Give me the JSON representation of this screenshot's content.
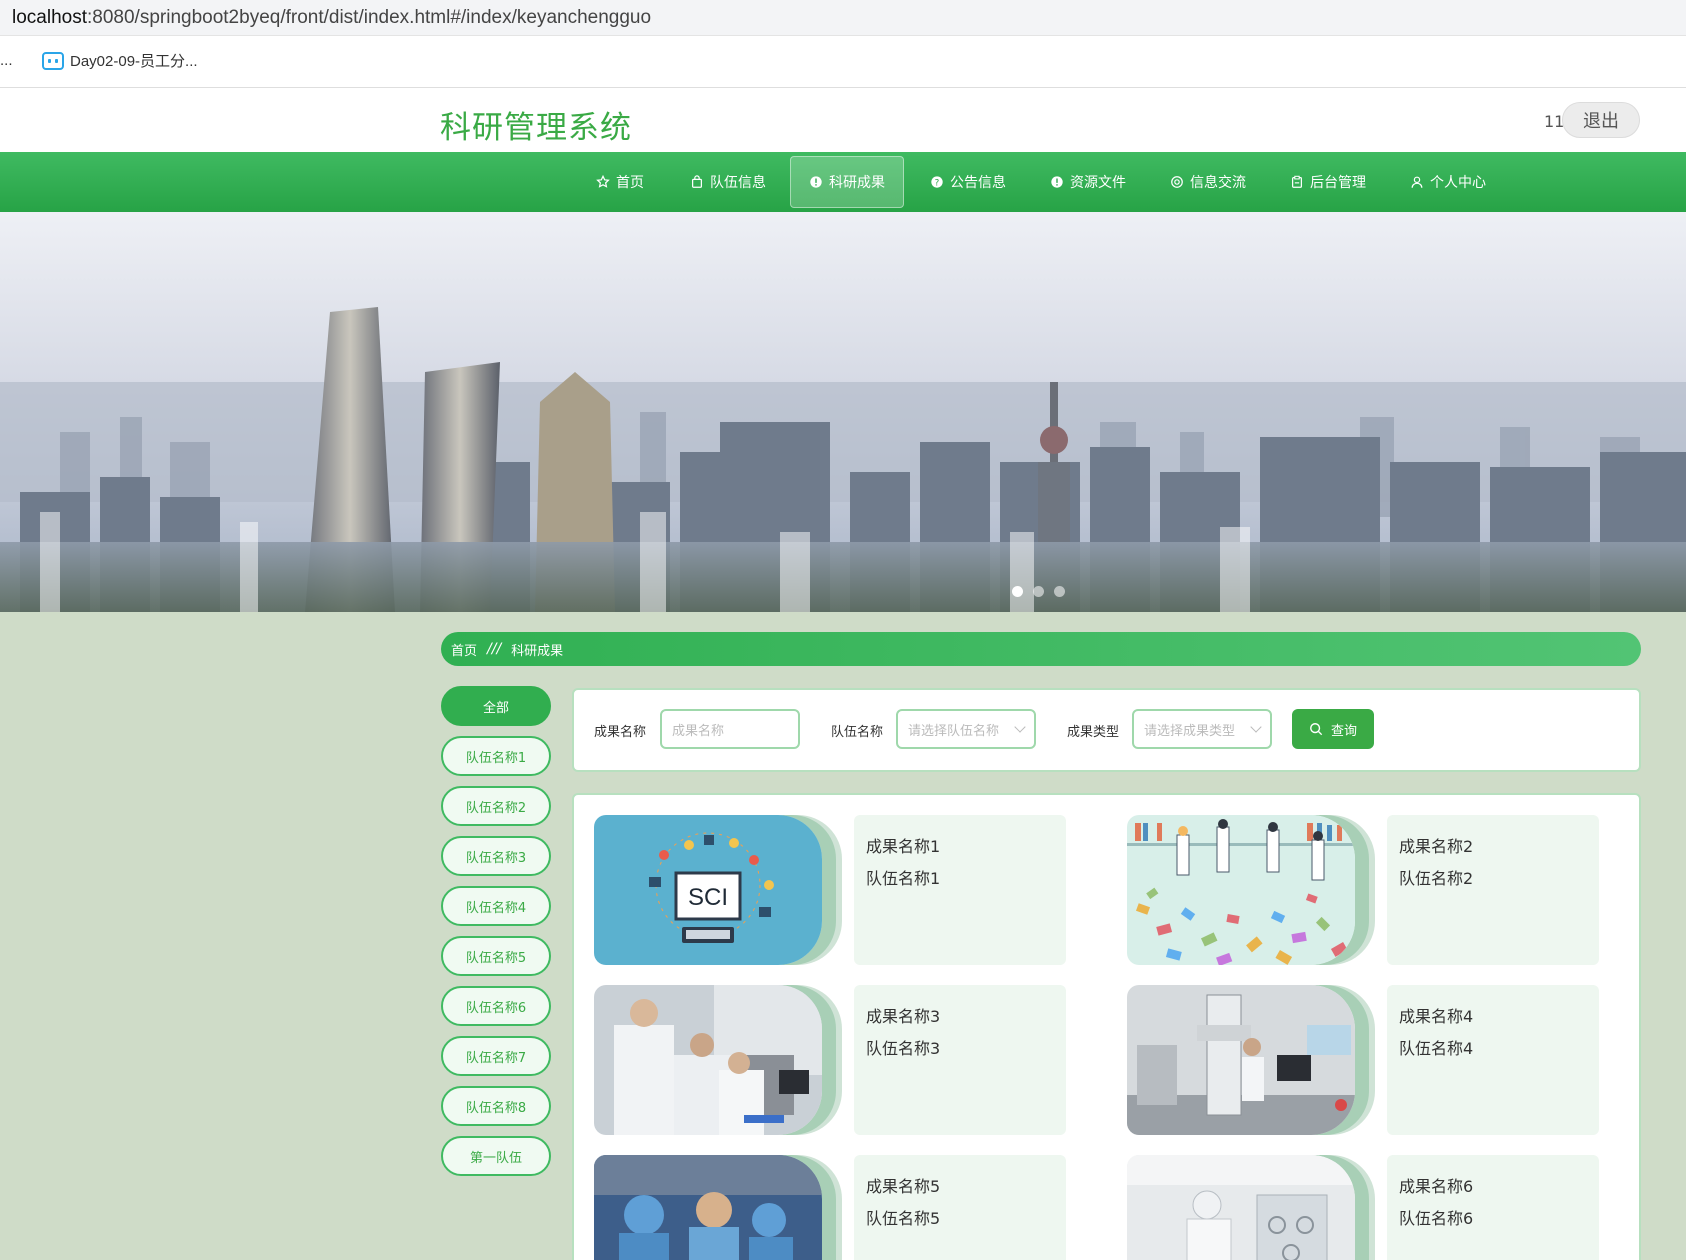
{
  "browser": {
    "url_host": "localhost",
    "url_rest": ":8080/springboot2byeq/front/dist/index.html#/index/keyanchengguo",
    "bookmark_ellipsis": "...",
    "bookmark": "Day02-09-员工分..."
  },
  "header": {
    "title": "科研管理系统",
    "user": "11",
    "logout": "退出"
  },
  "nav": [
    {
      "label": "首页",
      "icon": "star-icon"
    },
    {
      "label": "队伍信息",
      "icon": "bag-icon"
    },
    {
      "label": "科研成果",
      "icon": "info-icon",
      "active": true
    },
    {
      "label": "公告信息",
      "icon": "question-icon"
    },
    {
      "label": "资源文件",
      "icon": "info-icon"
    },
    {
      "label": "信息交流",
      "icon": "chat-icon"
    },
    {
      "label": "后台管理",
      "icon": "clipboard-icon"
    },
    {
      "label": "个人中心",
      "icon": "user-icon"
    }
  ],
  "breadcrumb": {
    "home": "首页",
    "sep": "///",
    "current": "科研成果"
  },
  "filters": [
    "全部",
    "队伍名称1",
    "队伍名称2",
    "队伍名称3",
    "队伍名称4",
    "队伍名称5",
    "队伍名称6",
    "队伍名称7",
    "队伍名称8",
    "第一队伍"
  ],
  "search": {
    "name_label": "成果名称",
    "name_placeholder": "成果名称",
    "team_label": "队伍名称",
    "team_placeholder": "请选择队伍名称",
    "type_label": "成果类型",
    "type_placeholder": "请选择成果类型",
    "button": "查询"
  },
  "results": [
    {
      "name": "成果名称1",
      "team": "队伍名称1",
      "image": "sci-illustration"
    },
    {
      "name": "成果名称2",
      "team": "队伍名称2",
      "image": "library-illustration"
    },
    {
      "name": "成果名称3",
      "team": "队伍名称3",
      "image": "lab-photo"
    },
    {
      "name": "成果名称4",
      "team": "队伍名称4",
      "image": "microscope-photo"
    },
    {
      "name": "成果名称5",
      "team": "队伍名称5",
      "image": "surgery-photo"
    },
    {
      "name": "成果名称6",
      "team": "队伍名称6",
      "image": "cleanroom-photo"
    }
  ],
  "sci_text": "SCI",
  "colors": {
    "primary": "#3aaa45",
    "nav": "#2ea84d"
  }
}
